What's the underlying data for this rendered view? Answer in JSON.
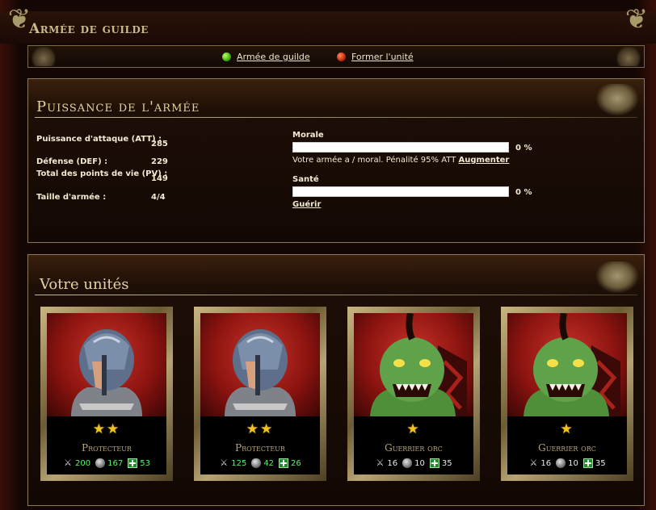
{
  "page": {
    "title": "Armée de guilde"
  },
  "nav": {
    "items": [
      {
        "label": "Armée de guilde",
        "status": "active",
        "color": "#3fae0d"
      },
      {
        "label": "Former l'unité",
        "status": "inactive",
        "color": "#c32a0e"
      }
    ]
  },
  "power": {
    "title": "Puissance de l'armée",
    "stats": [
      {
        "label": "Puissance d'attaque (ATT) :",
        "value": "285"
      },
      {
        "label": "Défense (DEF) :",
        "value": "229"
      },
      {
        "label": "Total des points de vie (PV) :",
        "value": "149"
      },
      {
        "label": "Taille d'armée :",
        "value": "4/4"
      }
    ],
    "morale": {
      "label": "Morale",
      "percent_text": "0 %",
      "percent": 0,
      "message": "Votre armée a / moral. Pénalité 95% ATT",
      "action": "Augmenter"
    },
    "health": {
      "label": "Santé",
      "percent_text": "0 %",
      "percent": 0,
      "action": "Guérir"
    }
  },
  "units": {
    "title": "Votre unités",
    "cards": [
      {
        "name": "Protecteur",
        "stars": "★★",
        "star_count": 2,
        "portrait": "knight-portrait",
        "att": "200",
        "def": "167",
        "hp": "53",
        "boosted": true
      },
      {
        "name": "Protecteur",
        "stars": "★★",
        "star_count": 2,
        "portrait": "knight-portrait",
        "att": "125",
        "def": "42",
        "hp": "26",
        "boosted": true
      },
      {
        "name": "Guerrier orc",
        "stars": "★",
        "star_count": 1,
        "portrait": "orc-portrait",
        "att": "16",
        "def": "10",
        "hp": "35",
        "boosted": false
      },
      {
        "name": "Guerrier orc",
        "stars": "★",
        "star_count": 1,
        "portrait": "orc-portrait",
        "att": "16",
        "def": "10",
        "hp": "35",
        "boosted": false
      }
    ]
  },
  "colors": {
    "accent_gold": "#c9b98c",
    "stat_green": "#5cf06a",
    "background": "#140604"
  }
}
